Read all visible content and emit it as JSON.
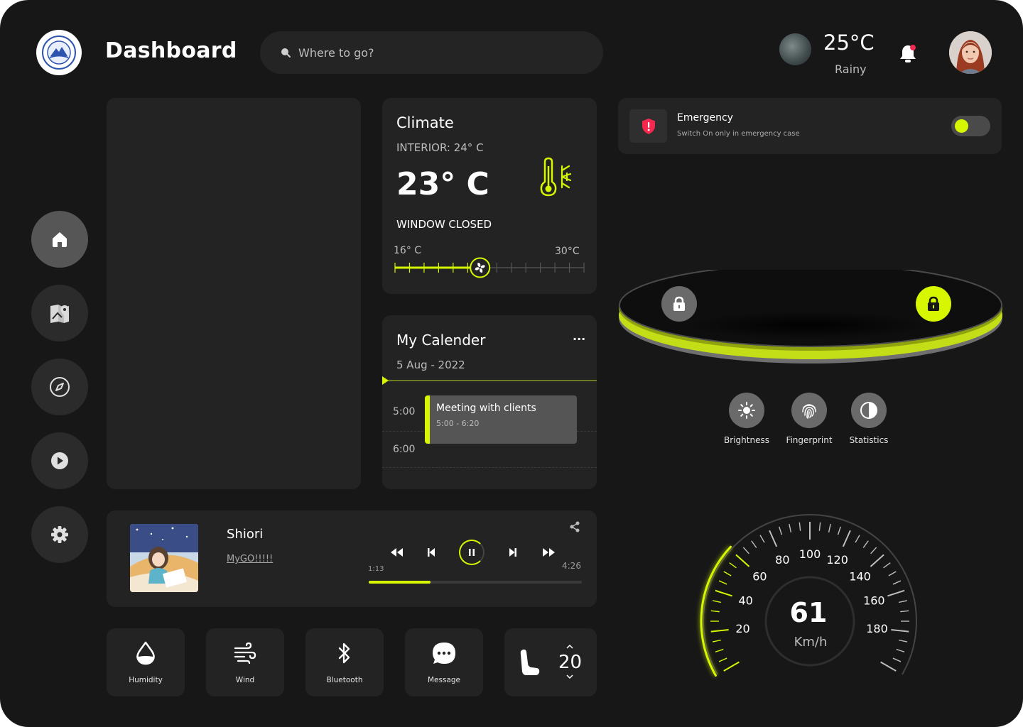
{
  "header": {
    "title": "Dashboard",
    "search_placeholder": "Where to go?",
    "temperature": "25°C",
    "weather": "Rainy"
  },
  "sidebar": {
    "items": [
      {
        "icon": "home-icon",
        "active": true
      },
      {
        "icon": "map-icon",
        "active": false
      },
      {
        "icon": "compass-icon",
        "active": false
      },
      {
        "icon": "play-icon",
        "active": false
      },
      {
        "icon": "settings-icon",
        "active": false
      }
    ]
  },
  "climate": {
    "title": "Climate",
    "interior": "INTERIOR: 24° C",
    "temperature": "23° C",
    "window": "WINDOW CLOSED",
    "min_label": "16° C",
    "max_label": "30°C",
    "level": 0.45
  },
  "calendar": {
    "title": "My Calender",
    "date": "5 Aug - 2022",
    "more_label": "···",
    "times": [
      "5:00",
      "6:00"
    ],
    "event": {
      "title": "Meeting with clients",
      "time": "5:00 - 6:20"
    }
  },
  "emergency": {
    "title": "Emergency",
    "subtitle": "Switch On only in emergency case",
    "enabled": false
  },
  "quick_actions": [
    {
      "label": "Brightness",
      "icon": "sun-icon"
    },
    {
      "label": "Fingerprint",
      "icon": "fingerprint-icon"
    },
    {
      "label": "Statistics",
      "icon": "contrast-icon"
    }
  ],
  "music": {
    "title": "Shiori",
    "artist": "MyGO!!!!!",
    "elapsed": "1:13",
    "duration": "4:26",
    "progress": 0.29
  },
  "tiles": [
    {
      "label": "Humidity",
      "icon": "droplet-icon"
    },
    {
      "label": "Wind",
      "icon": "wind-icon"
    },
    {
      "label": "Bluetooth",
      "icon": "bluetooth-icon"
    },
    {
      "label": "Message",
      "icon": "message-icon"
    }
  ],
  "seat": {
    "value": "20",
    "icon": "seat-icon"
  },
  "speedometer": {
    "value": "61",
    "unit": "Km/h",
    "ticks": [
      "20",
      "40",
      "60",
      "80",
      "100",
      "120",
      "140",
      "160",
      "180"
    ],
    "speed": 61,
    "max": 200
  },
  "colors": {
    "accent": "#D6F700",
    "background": "#171717",
    "card": "#232323",
    "danger": "#F5284F"
  }
}
